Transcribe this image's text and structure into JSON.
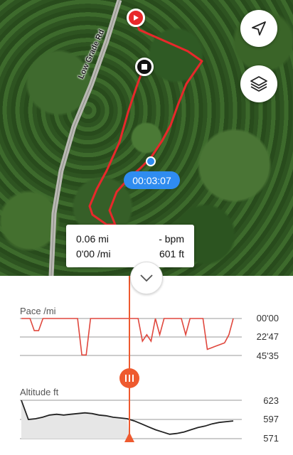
{
  "map": {
    "road_label": "Low Grade Rd",
    "elapsed_time": "00:03:07",
    "locate_icon": "navigation-arrow-icon",
    "layers_icon": "layers-icon",
    "start_icon": "play-icon",
    "end_icon": "stop-icon"
  },
  "info_card": {
    "distance": "0.06 mi",
    "heart_rate": "- bpm",
    "pace": "0'00 /mi",
    "altitude": "601 ft"
  },
  "pace_chart": {
    "title": "Pace /mi",
    "ticks": [
      "00'00",
      "22'47",
      "45'35"
    ]
  },
  "altitude_chart": {
    "title": "Altitude ft",
    "ticks": [
      "623",
      "597",
      "571"
    ]
  },
  "colors": {
    "track": "#e8282b",
    "cursor": "#ee5a2f",
    "accent_blue": "#2f8cf0",
    "pace_line": "#e0473d",
    "altitude_line": "#222222"
  },
  "chart_data": [
    {
      "type": "line",
      "title": "Pace /mi",
      "ylabel": "",
      "xlabel": "",
      "ylim_labels": [
        "00'00",
        "22'47",
        "45'35"
      ],
      "series": [
        {
          "values_minutes": [
            0,
            0,
            0,
            15,
            15,
            0,
            0,
            0,
            0,
            0,
            0,
            0,
            0,
            0,
            45,
            45,
            0,
            0,
            0,
            0,
            0,
            0,
            0,
            0,
            0,
            0,
            0,
            0,
            28,
            20,
            28,
            0,
            20,
            0,
            0,
            0,
            0,
            0,
            20,
            0,
            0,
            0,
            0,
            38,
            36,
            34,
            32,
            30,
            20,
            0
          ]
        }
      ]
    },
    {
      "type": "area",
      "title": "Altitude ft",
      "ylim": [
        571,
        623
      ],
      "series": [
        {
          "values": [
            623,
            597,
            598,
            600,
            603,
            604,
            603,
            604,
            605,
            606,
            605,
            603,
            602,
            600,
            599,
            598,
            595,
            591,
            587,
            583,
            580,
            577,
            578,
            580,
            583,
            586,
            588,
            591,
            593,
            594,
            595
          ]
        }
      ]
    }
  ]
}
